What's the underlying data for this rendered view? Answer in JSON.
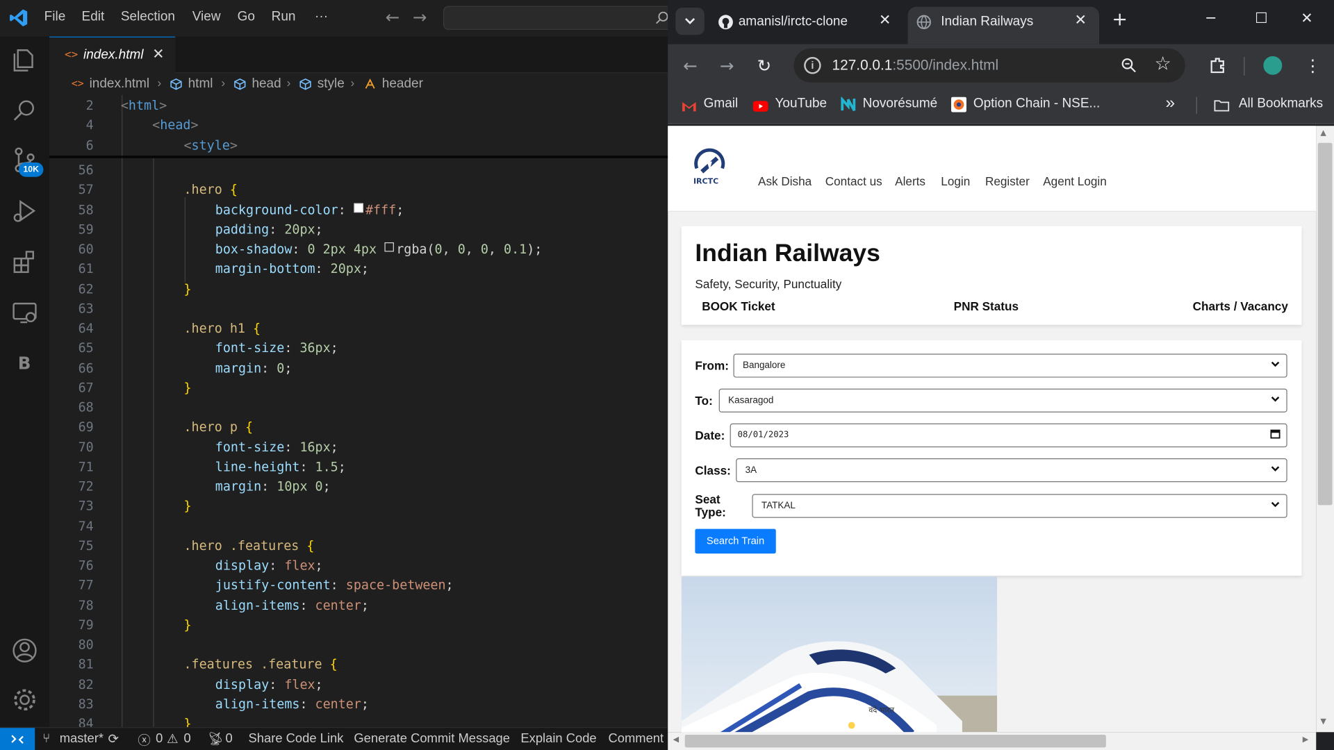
{
  "vscode": {
    "menu": [
      "File",
      "Edit",
      "Selection",
      "View",
      "Go",
      "Run",
      "···"
    ],
    "scm_badge": "10K",
    "tab": {
      "name": "index.html",
      "icon": "<>"
    },
    "breadcrumb": [
      "index.html",
      "html",
      "head",
      "style",
      "header"
    ],
    "sticky": [
      {
        "ln": "2",
        "code": "<html>"
      },
      {
        "ln": "4",
        "code": "<head>"
      },
      {
        "ln": "6",
        "code": "<style>"
      }
    ],
    "lines": [
      {
        "ln": "56",
        "code": ""
      },
      {
        "ln": "57",
        "code": ".hero {"
      },
      {
        "ln": "58",
        "code": "background-color: #fff;"
      },
      {
        "ln": "59",
        "code": "padding: 20px;"
      },
      {
        "ln": "60",
        "code": "box-shadow: 0 2px 4px rgba(0, 0, 0, 0.1);"
      },
      {
        "ln": "61",
        "code": "margin-bottom: 20px;"
      },
      {
        "ln": "62",
        "code": "}"
      },
      {
        "ln": "63",
        "code": ""
      },
      {
        "ln": "64",
        "code": ".hero h1 {"
      },
      {
        "ln": "65",
        "code": "font-size: 36px;"
      },
      {
        "ln": "66",
        "code": "margin: 0;"
      },
      {
        "ln": "67",
        "code": "}"
      },
      {
        "ln": "68",
        "code": ""
      },
      {
        "ln": "69",
        "code": ".hero p {"
      },
      {
        "ln": "70",
        "code": "font-size: 16px;"
      },
      {
        "ln": "71",
        "code": "line-height: 1.5;"
      },
      {
        "ln": "72",
        "code": "margin: 10px 0;"
      },
      {
        "ln": "73",
        "code": "}"
      },
      {
        "ln": "74",
        "code": ""
      },
      {
        "ln": "75",
        "code": ".hero .features {"
      },
      {
        "ln": "76",
        "code": "display: flex;"
      },
      {
        "ln": "77",
        "code": "justify-content: space-between;"
      },
      {
        "ln": "78",
        "code": "align-items: center;"
      },
      {
        "ln": "79",
        "code": "}"
      },
      {
        "ln": "80",
        "code": ""
      },
      {
        "ln": "81",
        "code": ".features .feature {"
      },
      {
        "ln": "82",
        "code": "display: flex;"
      },
      {
        "ln": "83",
        "code": "align-items: center;"
      },
      {
        "ln": "84",
        "code": "}"
      }
    ],
    "status": {
      "branch": "master*",
      "errors": "0",
      "warnings": "0",
      "ports": "0",
      "items": [
        "Share Code Link",
        "Generate Commit Message",
        "Explain Code",
        "Comment"
      ]
    }
  },
  "chrome": {
    "tabs": [
      {
        "title": "amanisl/irctc-clone",
        "active": false
      },
      {
        "title": "Indian Railways",
        "active": true
      }
    ],
    "url_host": "127.0.0.1",
    "url_rest": ":5500/index.html",
    "bookmarks": [
      "Gmail",
      "YouTube",
      "Novorésumé",
      "Option Chain - NSE..."
    ],
    "all_bookmarks": "All Bookmarks"
  },
  "page": {
    "logo_text": "IRCTC",
    "nav": [
      "Ask Disha",
      "Contact us",
      "Alerts",
      "Login",
      "Register",
      "Agent Login"
    ],
    "hero": {
      "title": "Indian Railways",
      "subtitle": "Safety, Security, Punctuality",
      "features": [
        "BOOK Ticket",
        "PNR Status",
        "Charts / Vacancy"
      ]
    },
    "form": {
      "from_label": "From:",
      "from_value": "Bangalore",
      "to_label": "To:",
      "to_value": "Kasaragod",
      "date_label": "Date:",
      "date_value": "08/01/2023",
      "class_label": "Class:",
      "class_value": "3A",
      "seat_label_1": "Seat",
      "seat_label_2": "Type:",
      "seat_value": "TATKAL",
      "search_button": "Search Train"
    },
    "train_text": "वंदे भारत"
  },
  "colors": {
    "vscode_accent": "#0078d4",
    "search_button": "#0a7cff",
    "irctc_navy": "#213d77"
  }
}
